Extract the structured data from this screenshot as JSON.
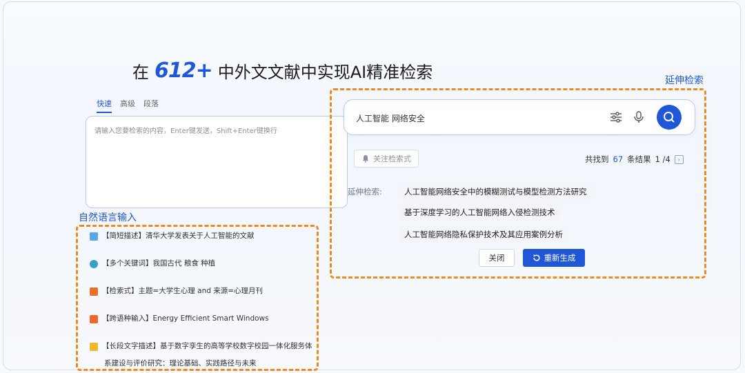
{
  "headline": {
    "prefix": "在",
    "brand": "612+",
    "suffix": "中外文文献中实现AI精准检索"
  },
  "annotations": {
    "extend": "延伸检索",
    "natural": "自然语言输入"
  },
  "search_modes": {
    "tabs": [
      "快速",
      "高级",
      "段落"
    ],
    "active": "快速"
  },
  "query_box": {
    "placeholder": "请输入您要检索的内容，Enter键发送，Shift+Enter键换行"
  },
  "examples": [
    {
      "icon": "book-icon",
      "color": "#5aa7e8",
      "text": "【简短描述】清华大学发表关于人工智能的文献"
    },
    {
      "icon": "globe-icon",
      "color": "#3aa0c8",
      "text": "【多个关键词】我国古代 粮食 种植"
    },
    {
      "icon": "formula-icon",
      "color": "#e8702a",
      "text": "【检索式】主题=大学生心理 and 来源=心理月刊"
    },
    {
      "icon": "translate-icon",
      "color": "#ef6a2a",
      "text": "【跨语种输入】Energy Efficient Smart Windows"
    },
    {
      "icon": "document-icon",
      "color": "#f2b52e",
      "text": "【长段文字描述】基于数字孪生的高等学校数字校园一体化服务体"
    }
  ],
  "example_continuation": "系建设与评价研究：理论基础、实践路径与未来",
  "search": {
    "value": "人工智能 网络安全"
  },
  "results": {
    "follow_label": "关注检索式",
    "prefix": "共找到",
    "count": "67",
    "suffix": "条结果",
    "page": "1 /4"
  },
  "extended": {
    "label": "延伸检索:",
    "items": [
      "人工智能网络安全中的模糊测试与模型检测方法研究",
      "基于深度学习的人工智能网络入侵检测技术",
      "人工智能网络隐私保护技术及其应用案例分析"
    ]
  },
  "buttons": {
    "close": "关闭",
    "regenerate": "重新生成"
  },
  "colors": {
    "accent": "#1f57d8",
    "highlight": "#ef8a22"
  }
}
